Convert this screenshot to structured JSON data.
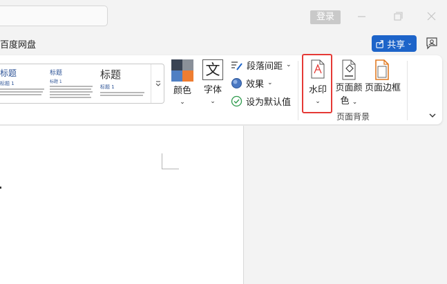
{
  "titlebar": {
    "login_label": "登录"
  },
  "menubar": {
    "tab_label": "百度网盘",
    "share_label": "共享"
  },
  "ribbon": {
    "styles_gallery": {
      "thumbs": [
        {
          "heading": "标题",
          "subheading": "标题 1"
        },
        {
          "heading": "标题",
          "subheading": "标题 1"
        },
        {
          "heading": "标题",
          "subheading": "标题 1"
        }
      ]
    },
    "colors_label": "颜色",
    "colors_swatches": [
      "#3a4454",
      "#8a9099",
      "#4f7fc3",
      "#ee7d31"
    ],
    "fonts_label": "字体",
    "fonts_glyph": "文",
    "paragraph_spacing_label": "段落间距",
    "effects_label": "效果",
    "set_default_label": "设为默认值",
    "watermark_label": "水印",
    "page_color_label_line1": "页面颜",
    "page_color_label_line2": "色",
    "page_border_label": "页面边框",
    "page_background_group_label": "页面背景"
  }
}
